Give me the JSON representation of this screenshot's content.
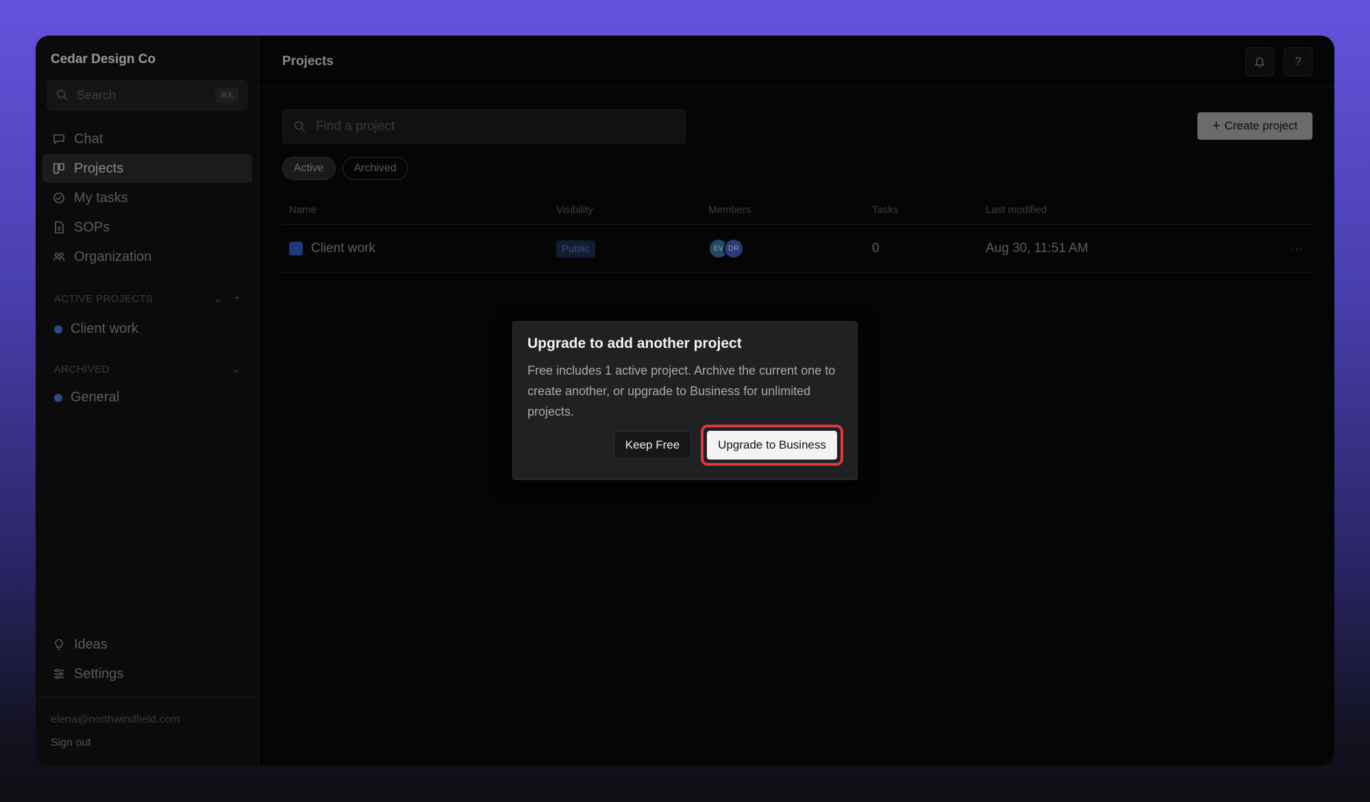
{
  "sidebar": {
    "brand": "Cedar Design Co",
    "search_placeholder": "Search",
    "search_shortcut": "⌘K",
    "nav": [
      {
        "label": "Chat",
        "icon": "chat-icon"
      },
      {
        "label": "Projects",
        "icon": "projects-icon",
        "active": true
      },
      {
        "label": "My tasks",
        "icon": "check-circle-icon"
      },
      {
        "label": "SOPs",
        "icon": "document-icon"
      },
      {
        "label": "Organization",
        "icon": "people-icon"
      }
    ],
    "active_projects_header": "ACTIVE PROJECTS",
    "active_projects": [
      {
        "label": "Client work"
      }
    ],
    "archived_header": "ARCHIVED",
    "archived_projects": [
      {
        "label": "General"
      }
    ],
    "bottom_nav": [
      {
        "label": "Ideas",
        "icon": "lightbulb-icon"
      },
      {
        "label": "Settings",
        "icon": "sliders-icon"
      }
    ],
    "email": "elena@northwindfield.com",
    "sign_out": "Sign out"
  },
  "header": {
    "title": "Projects",
    "help_label": "?"
  },
  "main": {
    "find_placeholder": "Find a project",
    "create_label": "Create project",
    "filters": [
      {
        "label": "Active",
        "active": true
      },
      {
        "label": "Archived"
      }
    ],
    "columns": [
      "Name",
      "Visibility",
      "Members",
      "Tasks",
      "Last modified"
    ],
    "rows": [
      {
        "name": "Client work",
        "visibility": "Public",
        "members": [
          "EV",
          "DR"
        ],
        "tasks": "0",
        "last_modified": "Aug 30, 11:51 AM",
        "more": "···"
      }
    ]
  },
  "modal": {
    "title": "Upgrade to add another project",
    "body": "Free includes 1 active project. Archive the current one to create another, or upgrade to Business for unlimited projects.",
    "keep_label": "Keep Free",
    "upgrade_label": "Upgrade to Business"
  },
  "colors": {
    "highlight": "#e0383d",
    "project_dot": "#2a4a8a"
  }
}
